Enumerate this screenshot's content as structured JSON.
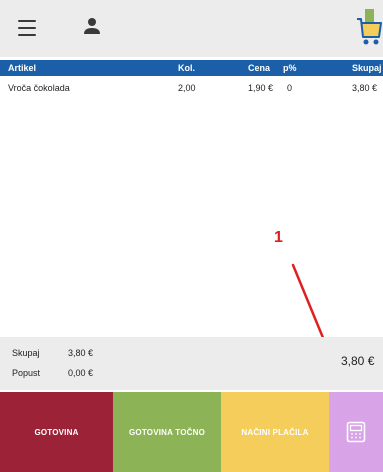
{
  "table": {
    "headers": {
      "article": "Artikel",
      "qty": "Kol.",
      "price": "Cena",
      "discount": "p%",
      "total": "Skupaj"
    },
    "rows": [
      {
        "article": "Vroča čokolada",
        "qty": "2,00",
        "price": "1,90 €",
        "discount": "0",
        "total": "3,80 €"
      }
    ]
  },
  "annotation": {
    "number": "1",
    "color": "#e02020"
  },
  "summary": {
    "total_label": "Skupaj",
    "total_value": "3,80 €",
    "discount_label": "Popust",
    "discount_value": "0,00 €",
    "grand_total": "3,80 €"
  },
  "payment": {
    "cash_label": "GOTOVINA",
    "exact_cash_label": "GOTOVINA TOČNO",
    "methods_label": "NAČINI PLAČILA",
    "terminal_icon": "card-terminal-icon"
  },
  "colors": {
    "header_bar": "#1a5fa8",
    "cash": "#9b2237",
    "exact_cash": "#8cb356",
    "methods": "#f4cd5a",
    "terminal": "#d9a3e8"
  }
}
